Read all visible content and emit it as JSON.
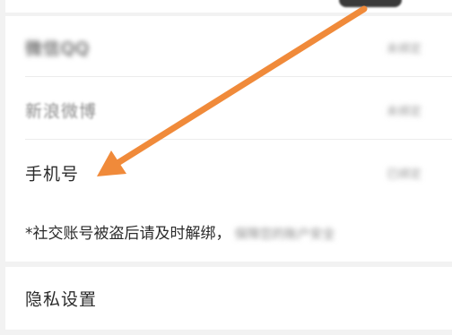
{
  "accounts": {
    "row1": {
      "label": "微信QQ",
      "value": "未绑定"
    },
    "row2": {
      "label": "新浪微博",
      "value": "未绑定"
    },
    "row3": {
      "label": "手机号",
      "value": "已绑定"
    },
    "note": {
      "text": "*社交账号被盗后请及时解绑，",
      "tail": "保障您的账户安全"
    }
  },
  "privacy": {
    "label": "隐私设置"
  },
  "colors": {
    "arrow": "#f08a3a",
    "background": "#f2f2f2",
    "card": "#ffffff"
  }
}
